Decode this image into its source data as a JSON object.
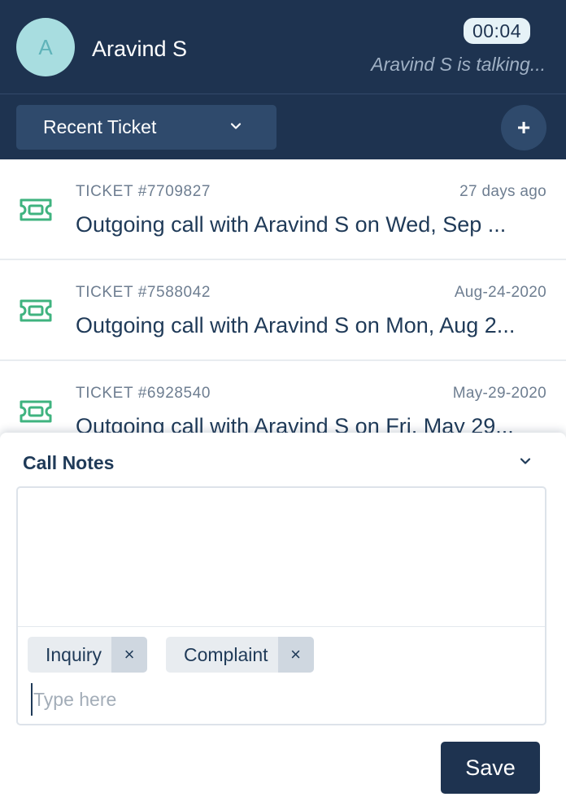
{
  "header": {
    "avatar_initial": "A",
    "caller_name": "Aravind S",
    "timer": "00:04",
    "status_text": "Aravind S is talking...",
    "ticket_dropdown": {
      "selected": "Recent Ticket"
    },
    "add_button_label": "+"
  },
  "tickets": [
    {
      "id": "TICKET #7709827",
      "date": "27 days ago",
      "title": "Outgoing call with Aravind S on Wed, Sep ..."
    },
    {
      "id": "TICKET #7588042",
      "date": "Aug-24-2020",
      "title": "Outgoing call with Aravind S on Mon, Aug 2..."
    },
    {
      "id": "TICKET #6928540",
      "date": "May-29-2020",
      "title": "Outgoing call with Aravind S on Fri, May 29..."
    }
  ],
  "call_notes": {
    "title": "Call Notes",
    "notes_value": "",
    "tags": [
      {
        "label": "Inquiry",
        "remove": "×"
      },
      {
        "label": "Complaint",
        "remove": "×"
      }
    ],
    "tag_input_placeholder": "Type here",
    "save_label": "Save"
  },
  "colors": {
    "header_bg": "#1e3350",
    "control_bg": "#2f4a6c",
    "ticket_icon": "#3fb37f",
    "avatar_bg": "#a8dde0",
    "tag_bg": "#e8ecf0"
  },
  "icons": {
    "ticket": "ticket-icon",
    "dropdown": "chevron-down-icon",
    "add": "plus-icon",
    "remove_tag": "close-icon"
  }
}
